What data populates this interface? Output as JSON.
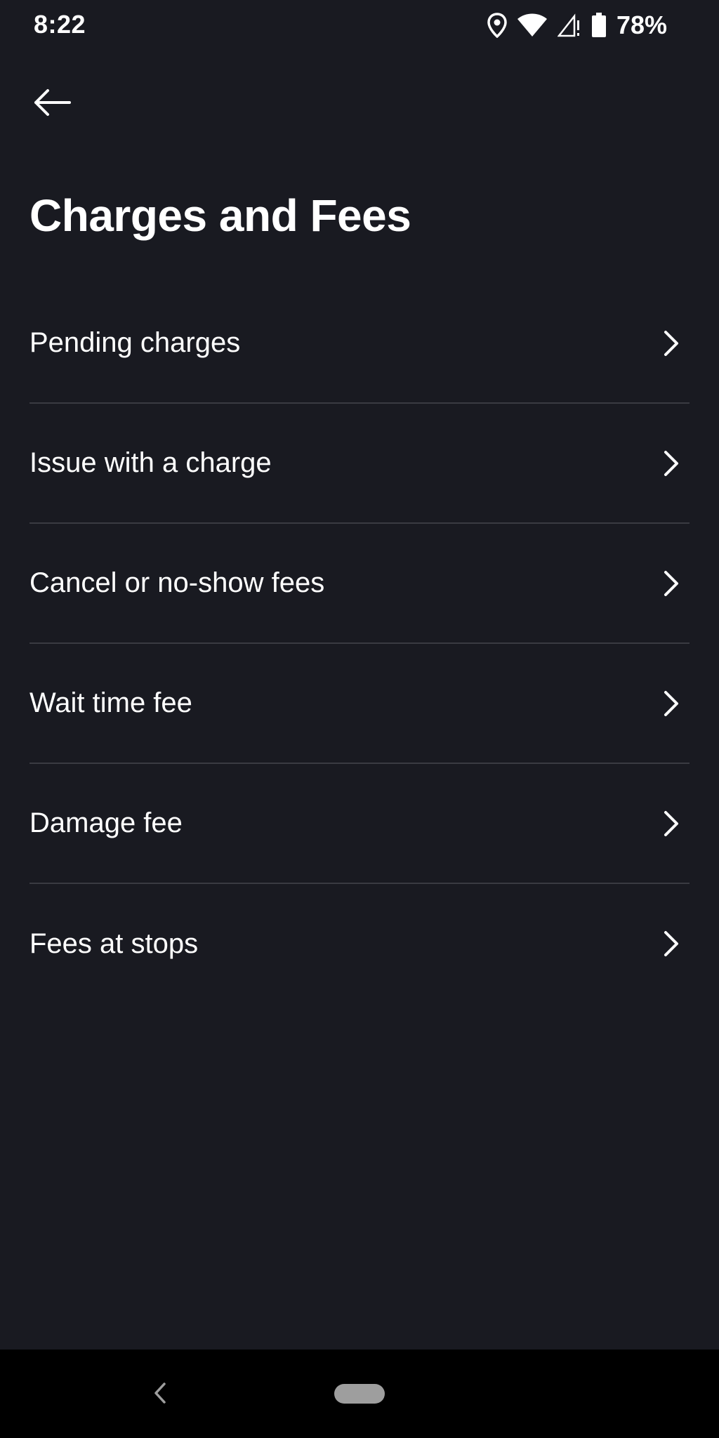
{
  "status_bar": {
    "time": "8:22",
    "battery_percent": "78%",
    "icons": [
      "location-icon",
      "wifi-icon",
      "signal-icon",
      "battery-icon"
    ]
  },
  "header": {
    "back_icon": "arrow-left-icon",
    "title": "Charges and Fees"
  },
  "menu": {
    "items": [
      {
        "label": "Pending charges",
        "icon": "chevron-right-icon"
      },
      {
        "label": "Issue with a charge",
        "icon": "chevron-right-icon"
      },
      {
        "label": "Cancel or no-show fees",
        "icon": "chevron-right-icon"
      },
      {
        "label": "Wait time fee",
        "icon": "chevron-right-icon"
      },
      {
        "label": "Damage fee",
        "icon": "chevron-right-icon"
      },
      {
        "label": "Fees at stops",
        "icon": "chevron-right-icon"
      }
    ]
  },
  "nav_bar": {
    "back_icon": "nav-back-icon",
    "home_icon": "home-pill-icon"
  },
  "colors": {
    "background": "#191a21",
    "text": "#ffffff",
    "divider": "#3a3b42",
    "nav_bar": "#000000",
    "home_pill": "#9e9e9e"
  }
}
